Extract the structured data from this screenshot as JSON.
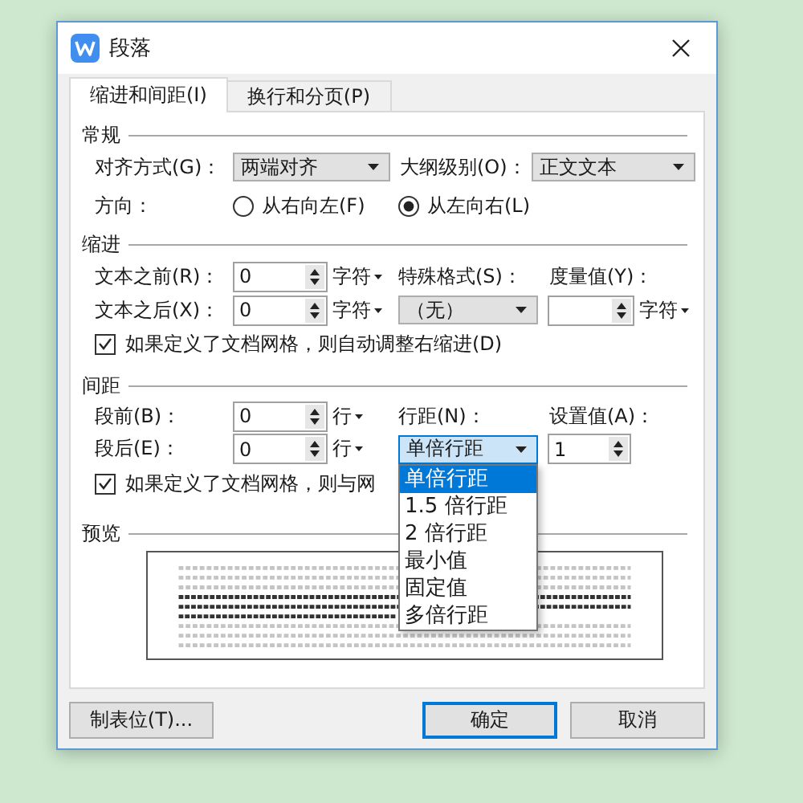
{
  "window": {
    "title": "段落"
  },
  "tabs": [
    {
      "label": "缩进和间距(I)",
      "selected": true
    },
    {
      "label": "换行和分页(P)",
      "selected": false
    }
  ],
  "general": {
    "heading": "常规",
    "alignment": {
      "label": "对齐方式(G)：",
      "value": "两端对齐"
    },
    "outline_level": {
      "label": "大纲级别(O)：",
      "value": "正文文本"
    },
    "direction": {
      "label": "方向：",
      "options": [
        {
          "label": "从右向左(F)",
          "selected": false
        },
        {
          "label": "从左向右(L)",
          "selected": true
        }
      ]
    }
  },
  "indent": {
    "heading": "缩进",
    "before": {
      "label": "文本之前(R)：",
      "value": "0",
      "unit": "字符"
    },
    "after": {
      "label": "文本之后(X)：",
      "value": "0",
      "unit": "字符"
    },
    "special": {
      "label": "特殊格式(S)：",
      "value": "（无）"
    },
    "measure": {
      "label": "度量值(Y)：",
      "unit": "字符"
    },
    "grid_check": {
      "label": "如果定义了文档网格，则自动调整右缩进(D)",
      "checked": true
    }
  },
  "spacing": {
    "heading": "间距",
    "before": {
      "label": "段前(B)：",
      "value": "0",
      "unit": "行"
    },
    "after": {
      "label": "段后(E)：",
      "value": "0",
      "unit": "行"
    },
    "line_spacing": {
      "label": "行距(N)：",
      "value": "单倍行距",
      "expanded": true,
      "options": [
        {
          "label": "单倍行距",
          "selected": true
        },
        {
          "label": "1.5 倍行距",
          "selected": false
        },
        {
          "label": "2 倍行距",
          "selected": false
        },
        {
          "label": "最小值",
          "selected": false
        },
        {
          "label": "固定值",
          "selected": false
        },
        {
          "label": "多倍行距",
          "selected": false
        }
      ]
    },
    "set_value": {
      "label": "设置值(A)：",
      "value": "1"
    },
    "grid_check": {
      "label": "如果定义了文档网格，则与网",
      "checked": true
    }
  },
  "preview": {
    "heading": "预览"
  },
  "footer": {
    "tab_stops": {
      "label": "制表位(T)..."
    },
    "buttons": [
      {
        "label": "确定",
        "default": true
      },
      {
        "label": "取消",
        "default": false
      }
    ]
  }
}
